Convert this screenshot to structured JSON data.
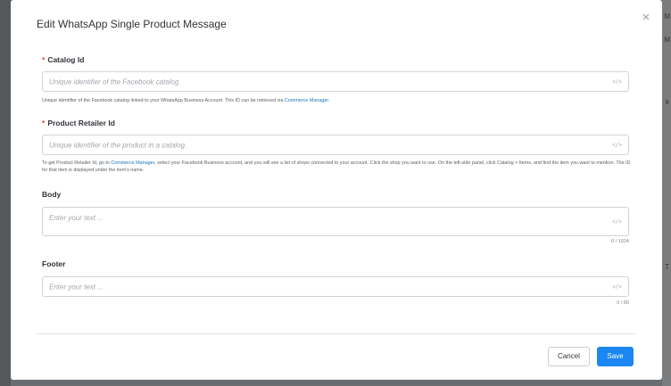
{
  "background": {
    "fragments": [
      "M",
      "M",
      "k",
      "T"
    ]
  },
  "dialog": {
    "title": "Edit WhatsApp Single Product Message",
    "close_glyph": "×"
  },
  "fields": {
    "catalog_id": {
      "required_mark": "*",
      "label": "Catalog Id",
      "placeholder": "Unique identifier of the Facebook catalog",
      "value": "",
      "help_before": "Unique identifier of the Facebook catalog linked to your WhatsApp Business Account. This ID can be retrieved via ",
      "help_link": "Commerce Manager",
      "help_after": "."
    },
    "product_retailer_id": {
      "required_mark": "*",
      "label": "Product Retailer Id",
      "placeholder": "Unique identifier of the product in a catalog.",
      "value": "",
      "help_before": "To get Product Retailer Id, go to ",
      "help_link": "Commerce Manager",
      "help_after": ", select your Facebook Business account, and you will see a list of shops connected to your account. Click the shop you want to use. On the left-side panel, click Catalog > Items, and find the item you want to mention. The ID for that item is displayed under the item's name."
    },
    "body": {
      "label": "Body",
      "placeholder": "Enter your text ...",
      "value": "",
      "counter": "0 / 1024"
    },
    "footer": {
      "label": "Footer",
      "placeholder": "Enter your text ...",
      "value": "",
      "counter": "0 / 60"
    }
  },
  "icons": {
    "code": "</>"
  },
  "actions": {
    "cancel_label": "Cancel",
    "save_label": "Save"
  },
  "colors": {
    "accent": "#1b87f2",
    "required": "#e0453a",
    "link": "#1a73c7"
  }
}
